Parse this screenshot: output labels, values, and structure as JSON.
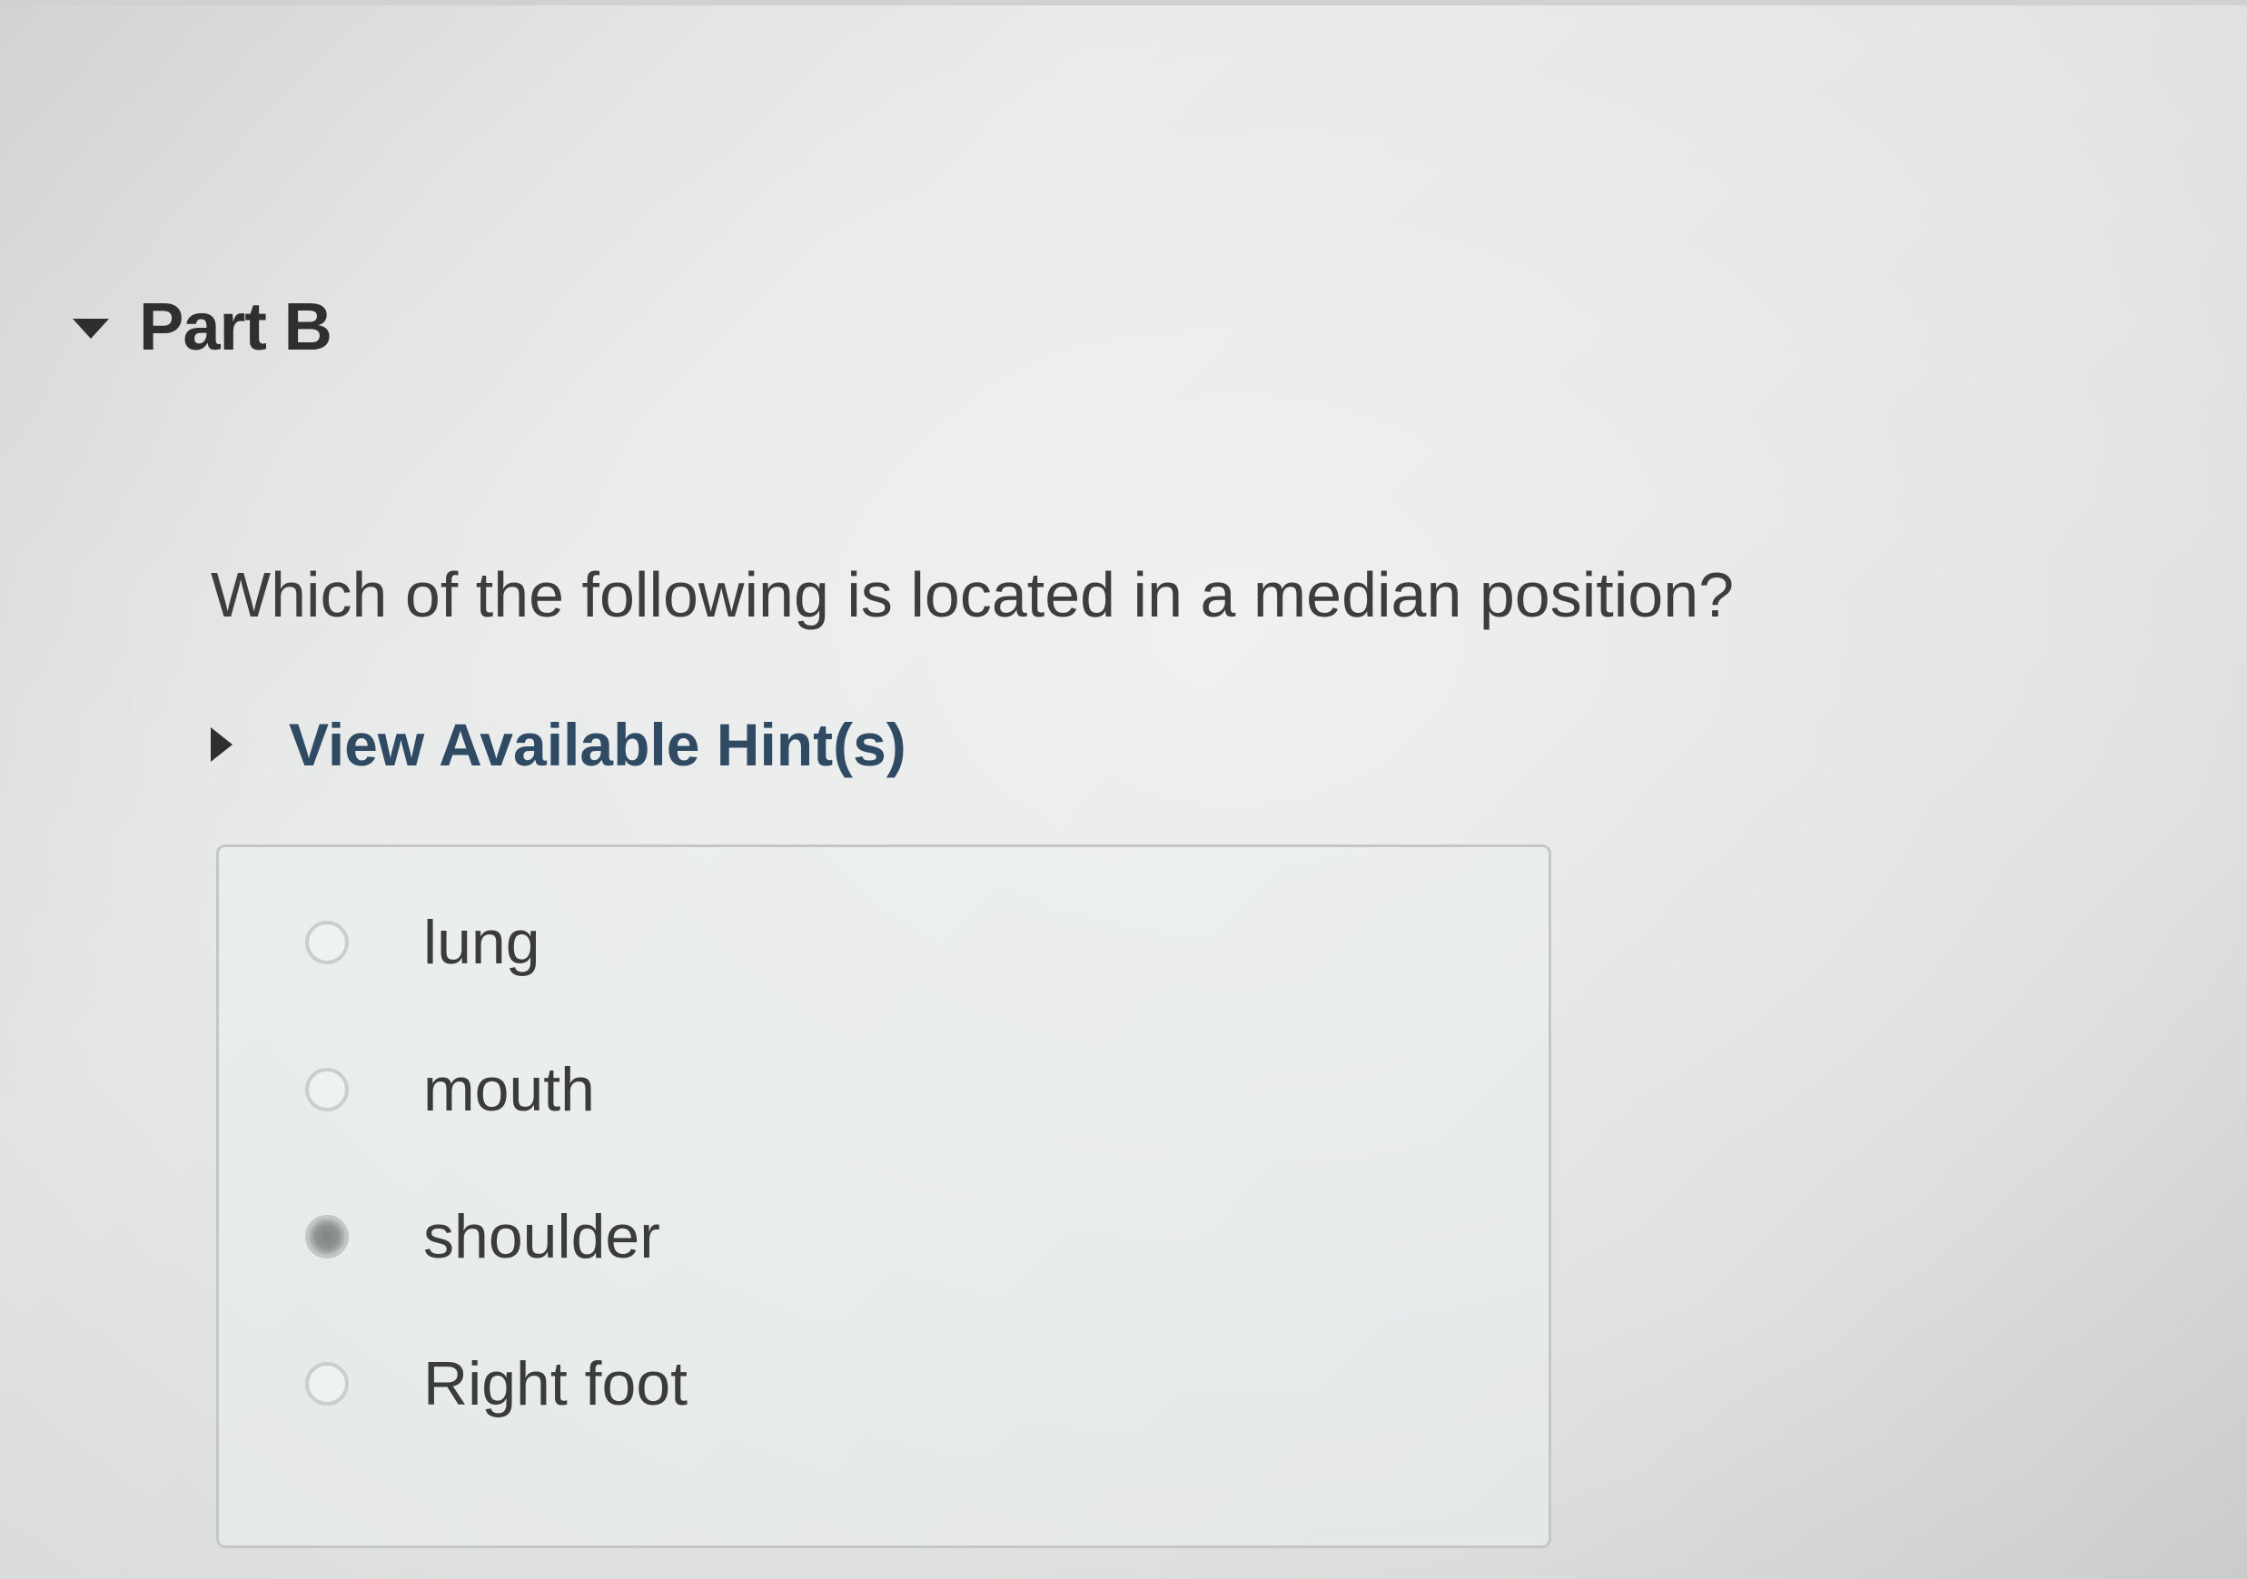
{
  "part": {
    "title": "Part B",
    "expanded": true
  },
  "question": {
    "text": "Which of the following is located in a median position?"
  },
  "hints": {
    "label": "View Available Hint(s)",
    "expanded": false
  },
  "answers": {
    "selected_index": 2,
    "options": [
      {
        "label": "lung"
      },
      {
        "label": "mouth"
      },
      {
        "label": "shoulder"
      },
      {
        "label": "Right foot"
      }
    ]
  },
  "colors": {
    "hint_link": "#2f4a63",
    "text": "#3b3b3b",
    "box_border": "#c4c7c6"
  }
}
